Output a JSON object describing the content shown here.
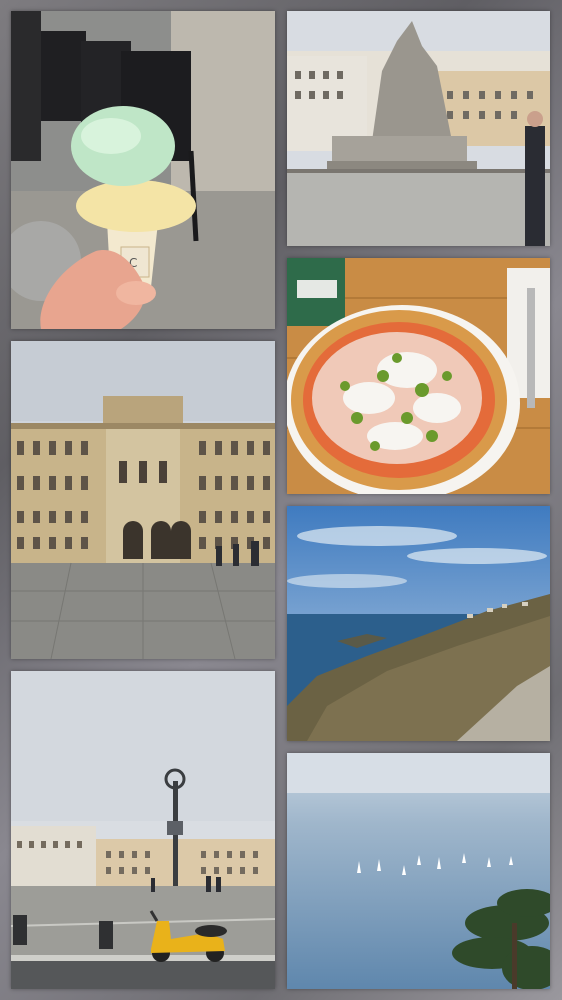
{
  "collage": {
    "tiles": [
      {
        "id": "gelato-cone"
      },
      {
        "id": "fountain-of-four-continents"
      },
      {
        "id": "pizza-plate"
      },
      {
        "id": "government-palace"
      },
      {
        "id": "coastal-cliff-view"
      },
      {
        "id": "square-with-lamppost-and-scooter"
      },
      {
        "id": "sea-with-sailboats"
      }
    ]
  },
  "colors": {
    "frame_gray": "#6e6d72",
    "sky_overcast": "#d9dde2",
    "stone_pavement": "#8a8a86",
    "scooter_yellow": "#e9b21a",
    "sea_blue": "#2c5f8c",
    "pizza_crust": "#d99a4a"
  },
  "texts": {
    "gelato_cup_label": "C"
  }
}
